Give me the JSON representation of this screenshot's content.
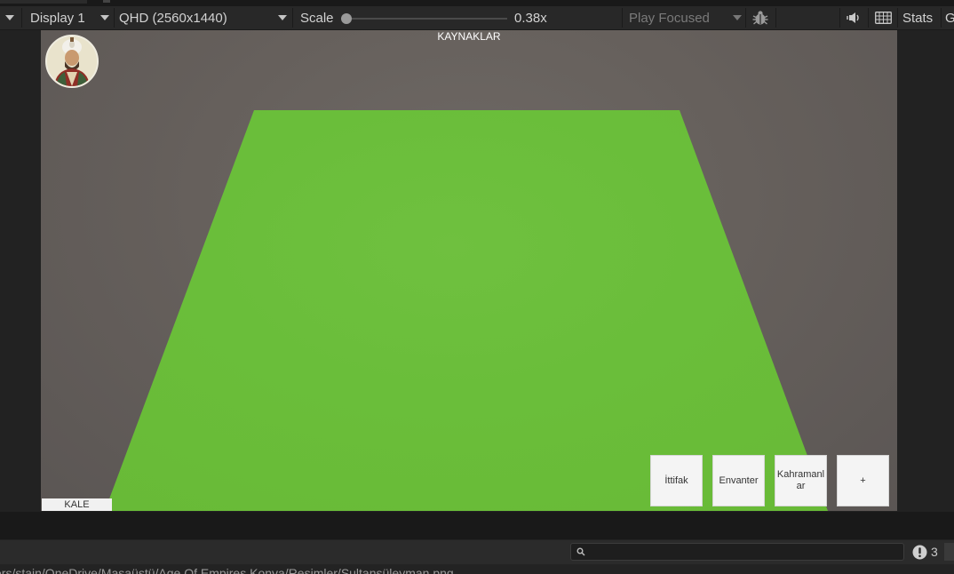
{
  "toolbar": {
    "display_label": "Display 1",
    "resolution_label": "QHD (2560x1440)",
    "scale_label": "Scale",
    "scale_value": "0.38x",
    "scale_fraction": 0.0,
    "play_mode_label": "Play Focused",
    "stats_label": "Stats",
    "gizmos_label": "G",
    "icons": {
      "debug": "bug-icon",
      "audio": "speaker-icon",
      "grid": "keyboard-icon"
    }
  },
  "game": {
    "resources_label": "KAYNAKLAR",
    "castle_label": "KALE",
    "buttons": [
      {
        "label": "İttifak"
      },
      {
        "label": "Envanter"
      },
      {
        "label": "Kahramanlar"
      },
      {
        "label": "+"
      }
    ],
    "colors": {
      "ground": "#6abe3a",
      "sky": "#66605c"
    }
  },
  "console": {
    "search_placeholder": "",
    "message_count": "3",
    "icons": {
      "search": "search-icon",
      "info": "exclamation-icon"
    }
  },
  "status": {
    "path": "ers/stajn/OneDrive/Masaüstü/Age Of Empires Konya/Resimler/Sultansüleyman.png"
  }
}
